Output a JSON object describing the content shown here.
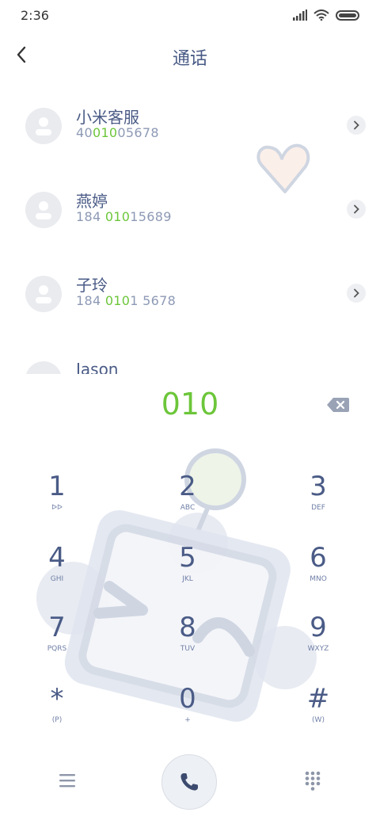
{
  "status_bar": {
    "time": "2:36"
  },
  "header": {
    "title": "通话"
  },
  "contacts": [
    {
      "name": "小米客服",
      "number_pre": "40",
      "number_match": "010",
      "number_post": "05678"
    },
    {
      "name": "燕婷",
      "number_pre": "184 ",
      "number_match": "010",
      "number_post": "15689"
    },
    {
      "name": "子玲",
      "number_pre": "184 ",
      "number_match": "010",
      "number_post": "1 5678"
    },
    {
      "name": "Jason"
    }
  ],
  "dialer": {
    "input": "010",
    "keys": [
      {
        "digit": "1",
        "letters": "ᐅᐅ"
      },
      {
        "digit": "2",
        "letters": "ABC"
      },
      {
        "digit": "3",
        "letters": "DEF"
      },
      {
        "digit": "4",
        "letters": "GHI"
      },
      {
        "digit": "5",
        "letters": "JKL"
      },
      {
        "digit": "6",
        "letters": "MNO"
      },
      {
        "digit": "7",
        "letters": "PQRS"
      },
      {
        "digit": "8",
        "letters": "TUV"
      },
      {
        "digit": "9",
        "letters": "WXYZ"
      },
      {
        "digit": "*",
        "letters": "(P)"
      },
      {
        "digit": "0",
        "letters": "+"
      },
      {
        "digit": "#",
        "letters": "(W)"
      }
    ]
  },
  "colors": {
    "accent": "#6cc63a",
    "text": "#4a5b86",
    "muted": "#8d99b5"
  },
  "icons": [
    "back-arrow-icon",
    "chevron-right-icon",
    "backspace-icon",
    "menu-icon",
    "phone-icon",
    "dialpad-grid-icon",
    "heart-icon",
    "robot-icon"
  ]
}
